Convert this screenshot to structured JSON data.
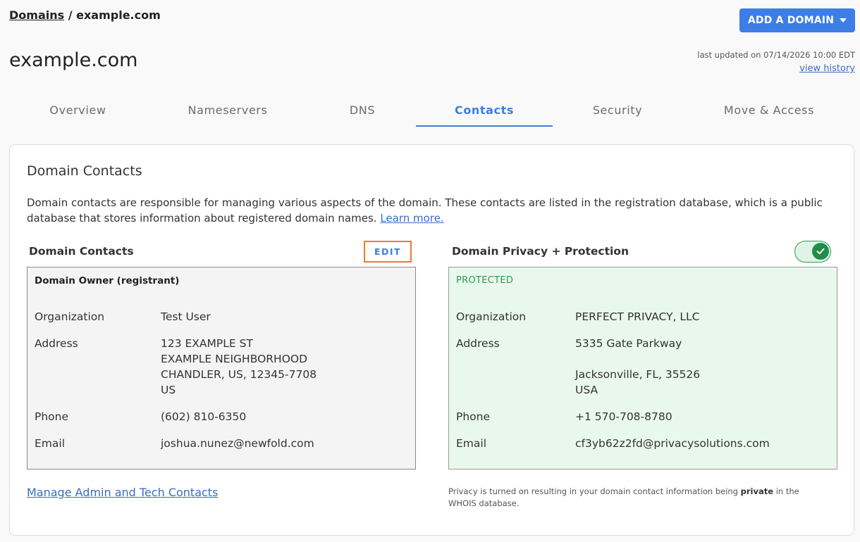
{
  "breadcrumb": {
    "parent": "Domains",
    "separator": " / ",
    "current": "example.com"
  },
  "header": {
    "add_domain_label": "ADD A DOMAIN",
    "title": "example.com",
    "last_updated": "last updated on 07/14/2026 10:00 EDT",
    "view_history": "view history"
  },
  "tabs": [
    {
      "label": "Overview"
    },
    {
      "label": "Nameservers"
    },
    {
      "label": "DNS"
    },
    {
      "label": "Contacts"
    },
    {
      "label": "Security"
    },
    {
      "label": "Move & Access"
    }
  ],
  "active_tab": "Contacts",
  "card": {
    "title": "Domain Contacts",
    "description": "Domain contacts are responsible for managing various aspects of the domain. These contacts are listed in the registration database, which is a public database that stores information about registered domain names. ",
    "learn_more": "Learn more."
  },
  "contacts": {
    "heading": "Domain Contacts",
    "edit_label": "EDIT",
    "owner_title": "Domain Owner (registrant)",
    "labels": {
      "organization": "Organization",
      "address": "Address",
      "phone": "Phone",
      "email": "Email"
    },
    "organization": "Test User",
    "address": [
      "123 EXAMPLE ST",
      "EXAMPLE NEIGHBORHOOD",
      "CHANDLER, US, 12345-7708",
      "US"
    ],
    "phone": "(602) 810-6350",
    "email": "joshua.nunez@newfold.com",
    "manage_link": "Manage Admin and Tech Contacts"
  },
  "privacy": {
    "heading": "Domain Privacy + Protection",
    "enabled": true,
    "status": "PROTECTED",
    "labels": {
      "organization": "Organization",
      "address": "Address",
      "phone": "Phone",
      "email": "Email"
    },
    "organization": "PERFECT PRIVACY, LLC",
    "address": [
      "5335 Gate Parkway",
      "",
      "Jacksonville, FL, 35526",
      "USA"
    ],
    "phone": "+1 570-708-8780",
    "email": "cf3yb62z2fd@privacysolutions.com",
    "note_before": "Privacy is turned on resulting in your domain contact information being ",
    "note_bold": "private",
    "note_after": " in the WHOIS database."
  },
  "colors": {
    "accent": "#3d7de6",
    "edit_highlight": "#f07a2c",
    "protected_green": "#2f9a55"
  },
  "icons": {
    "add_domain": "caret-down-icon",
    "privacy_toggle": "checkmark-icon"
  }
}
